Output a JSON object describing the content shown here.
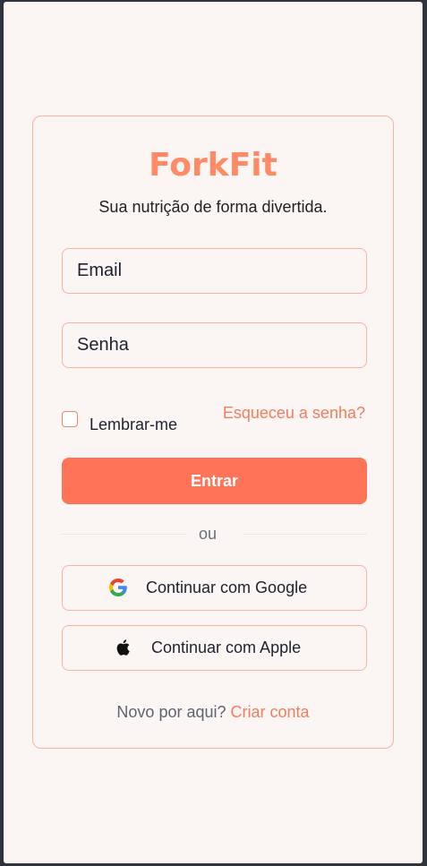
{
  "app": {
    "brand": "ForkFit",
    "tagline": "Sua nutrição de forma divertida."
  },
  "form": {
    "email_placeholder": "Email",
    "password_placeholder": "Senha",
    "remember_label": "Lembrar-me",
    "forgot_link": "Esqueceu a senha?",
    "submit_label": "Entrar",
    "divider_text": "ou"
  },
  "social": {
    "google_label": "Continuar com Google",
    "apple_label": "Continuar com Apple"
  },
  "signup": {
    "prompt": "Novo por aqui?",
    "link": "Criar conta"
  },
  "theme": {
    "accent": "#ff8a65",
    "button": "#ff7458",
    "border": "#f8b3a1",
    "background": "#fbf5f4"
  },
  "icons": {
    "google": "google-icon",
    "apple": "apple-icon"
  }
}
